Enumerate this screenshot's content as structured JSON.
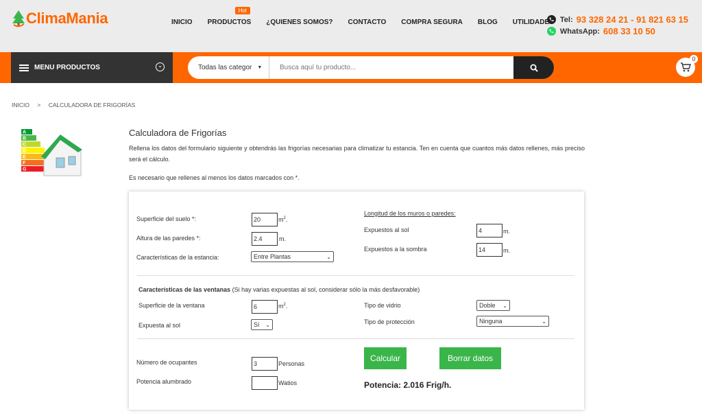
{
  "logo": {
    "text": "ClimaMania"
  },
  "nav": {
    "items": [
      "INICIO",
      "PRODUCTOS",
      "¿QUIENES SOMOS?",
      "CONTACTO",
      "COMPRA SEGURA",
      "BLOG",
      "UTILIDADES"
    ],
    "hot_badge": "Hot"
  },
  "contact": {
    "tel_label": "Tel:",
    "tel_value": "93 328 24 21 - 91 821 63 15",
    "whatsapp_label": "WhatsApp:",
    "whatsapp_value": "608 33 10 50"
  },
  "menu": {
    "label": "MENU PRODUCTOS"
  },
  "search": {
    "category": "Todas las categor",
    "placeholder": "Busca aquí tu producto..."
  },
  "cart": {
    "count": "0"
  },
  "breadcrumb": {
    "home": "INICIO",
    "sep": ">",
    "current": "CALCULADORA DE FRIGORÍAS"
  },
  "page": {
    "title": "Calculadora de Frigorías",
    "intro": "Rellena los datos del formulario siguiente y obtendrás las frigorías necesarias para climatizar tu estancia. Ten en cuenta que cuantos más datos rellenes, más preciso será el cálculo.",
    "note": "Es necesario que rellenes al menos los datos marcados con *."
  },
  "energy_labels": [
    "A",
    "B",
    "C",
    "D",
    "E",
    "F",
    "G"
  ],
  "form": {
    "floor_area": {
      "label": "Superficie del suelo *:",
      "value": "20",
      "unit": "m",
      "sup": "2",
      "tail": "."
    },
    "wall_height": {
      "label": "Altura de las paredes *:",
      "value": "2.4",
      "unit": "m."
    },
    "room_type": {
      "label": "Características de la estancia:",
      "value": "Entre Plantas"
    },
    "walls_header": "Longitud de los muros o paredes:",
    "sun_walls": {
      "label": "Expuestos al sol",
      "value": "4",
      "unit": "m."
    },
    "shade_walls": {
      "label": "Expuestos a la sombra",
      "value": "14",
      "unit": "m."
    },
    "windows_header_bold": "Características de las ventanas",
    "windows_header_note": " (Si hay varias expuestas al sol, considerar sólo la más desfavorable)",
    "window_area": {
      "label": "Superficie de la ventana",
      "value": "6",
      "unit": "m",
      "sup": "2",
      "tail": "."
    },
    "sun_exposed": {
      "label": "Expuesta al sol",
      "value": "Sí"
    },
    "glass_type": {
      "label": "Tipo de vidrio",
      "value": "Doble"
    },
    "protection": {
      "label": "Tipo de protección",
      "value": "Ninguna"
    },
    "occupants": {
      "label": "Número de ocupantes",
      "value": "3",
      "unit": "Personas"
    },
    "lighting": {
      "label": "Potencia alumbrado",
      "value": "",
      "unit": "Watios"
    },
    "calc_button": "Calcular",
    "clear_button": "Borrar datos",
    "result": "Potencia: 2.016 Frig/h."
  },
  "colors": {
    "accent": "#ff6600",
    "green": "#3ab54a",
    "dark": "#333333"
  }
}
